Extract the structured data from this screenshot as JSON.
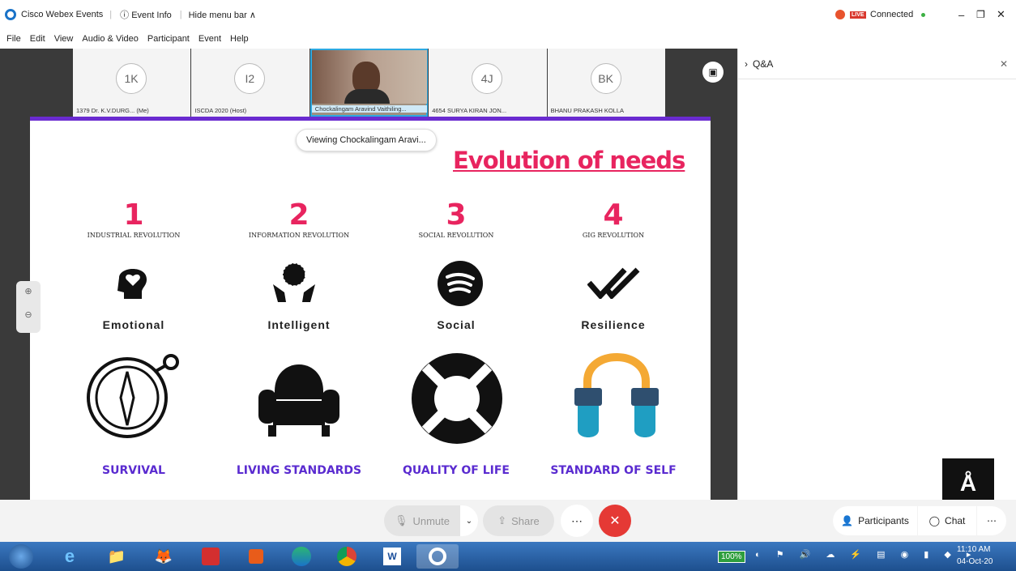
{
  "titlebar": {
    "app": "Cisco Webex Events",
    "event_info": "ⓘ Event Info",
    "hide_menu": "Hide menu bar ∧",
    "live": "LIVE",
    "connected": "Connected"
  },
  "menu": [
    "File",
    "Edit",
    "View",
    "Audio & Video",
    "Participant",
    "Event",
    "Help"
  ],
  "participants": [
    {
      "initials": "1K",
      "label": "1379 Dr. K.V.DURG... (Me)"
    },
    {
      "initials": "I2",
      "label": "ISCDA 2020 (Host)"
    },
    {
      "initials": "",
      "label": "Chockalingam Aravind Vaithiling..."
    },
    {
      "initials": "4J",
      "label": "4654 SURYA KIRAN JON..."
    },
    {
      "initials": "BK",
      "label": "BHANU PRAKASH KOLLA"
    }
  ],
  "viewing": "Viewing Chockalingam Aravi...",
  "qa_title": "Q&A",
  "slide": {
    "title": "Evolution of needs",
    "columns": [
      {
        "num": "1",
        "rev": "INDUSTRIAL REVOLUTION",
        "need": "Emotional",
        "bottom": "SURVIVAL"
      },
      {
        "num": "2",
        "rev": "INFORMATION REVOLUTION",
        "need": "Intelligent",
        "bottom": "LIVING STANDARDS"
      },
      {
        "num": "3",
        "rev": "SOCIAL REVOLUTION",
        "need": "Social",
        "bottom": "QUALITY OF LIFE"
      },
      {
        "num": "4",
        "rev": "GIG REVOLUTION",
        "need": "Resilience",
        "bottom": "STANDARD OF SELF"
      }
    ]
  },
  "controls": {
    "unmute": "Unmute",
    "share": "Share",
    "participants": "Participants",
    "chat": "Chat"
  },
  "taskbar": {
    "battery": "100%",
    "time": "11:10 AM",
    "date": "04-Oct-20"
  },
  "colors": {
    "accent": "#e8245f",
    "purple": "#5a2bd0",
    "end": "#e53935"
  }
}
